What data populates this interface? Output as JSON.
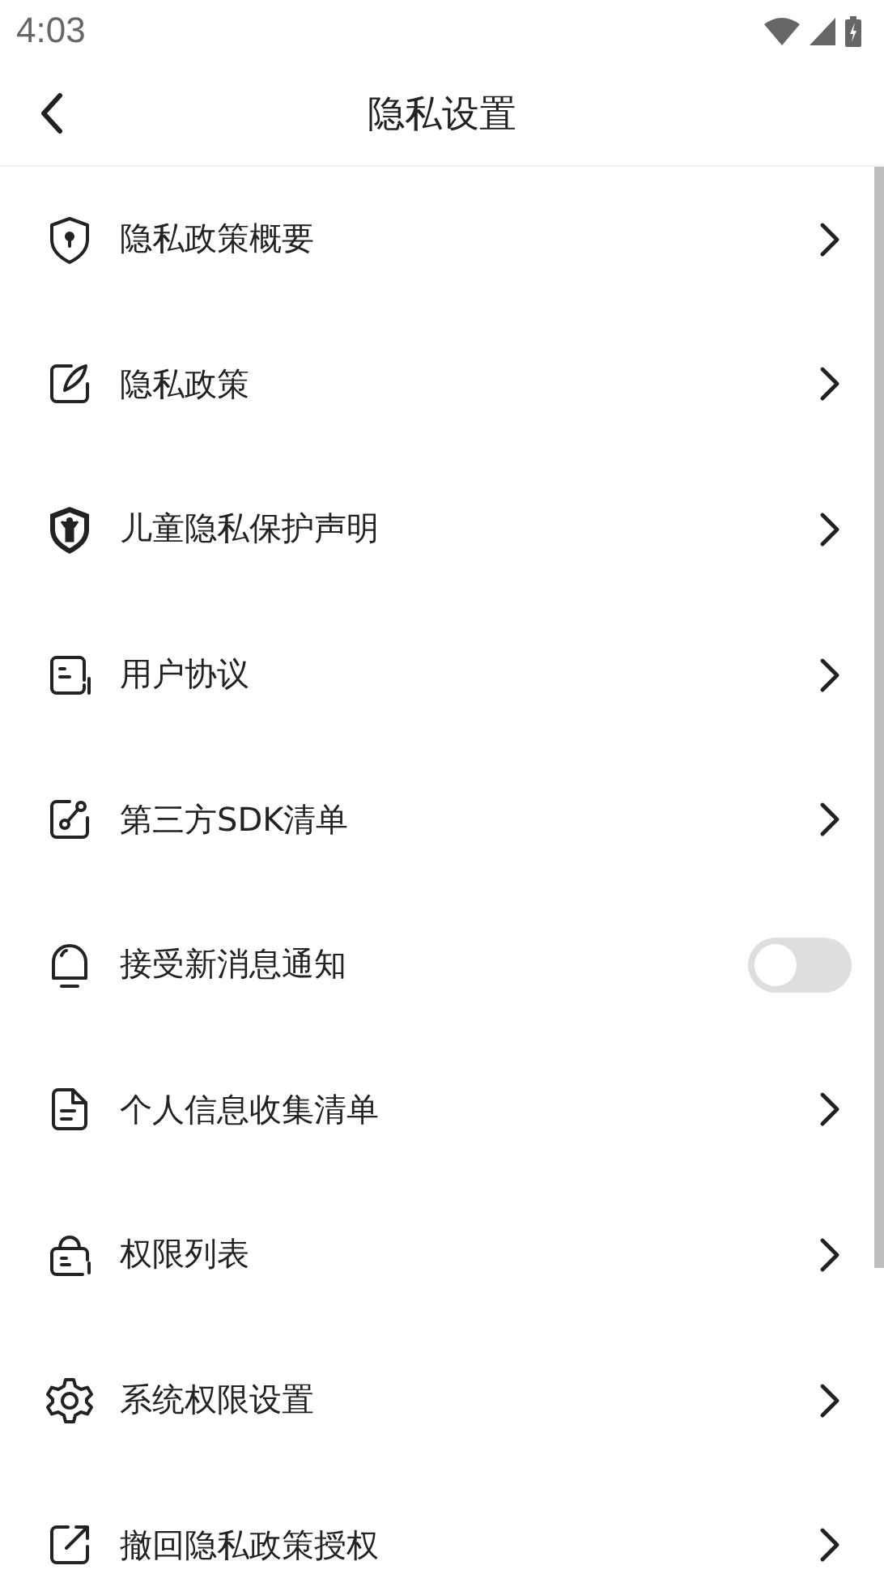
{
  "status_bar": {
    "time": "4:03"
  },
  "header": {
    "title": "隐私设置"
  },
  "items": [
    {
      "label": "隐私政策概要",
      "kind": "link"
    },
    {
      "label": "隐私政策",
      "kind": "link"
    },
    {
      "label": "儿童隐私保护声明",
      "kind": "link"
    },
    {
      "label": "用户协议",
      "kind": "link"
    },
    {
      "label": "第三方SDK清单",
      "kind": "link"
    },
    {
      "label": "接受新消息通知",
      "kind": "toggle",
      "on": false
    },
    {
      "label": "个人信息收集清单",
      "kind": "link"
    },
    {
      "label": "权限列表",
      "kind": "link"
    },
    {
      "label": "系统权限设置",
      "kind": "link"
    },
    {
      "label": "撤回隐私政策授权",
      "kind": "link"
    }
  ]
}
